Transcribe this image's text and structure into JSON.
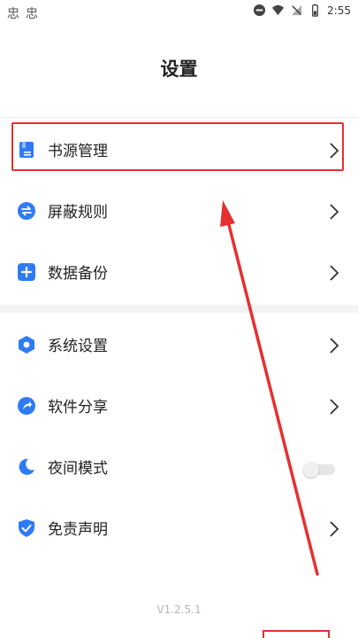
{
  "status_bar": {
    "left_icons": [
      "忠",
      "忠"
    ],
    "time": "2:55",
    "icons": [
      "dnd-icon",
      "wifi-icon",
      "signal-icon",
      "battery-icon"
    ]
  },
  "page": {
    "title": "设置",
    "version": "V1.2.5.1"
  },
  "settings": {
    "group1": [
      {
        "label": "书源管理",
        "icon": "book-source-icon",
        "color": "#2f7bf5"
      },
      {
        "label": "屏蔽规则",
        "icon": "swap-icon",
        "color": "#2f7bf5"
      },
      {
        "label": "数据备份",
        "icon": "backup-icon",
        "color": "#2f7bf5"
      }
    ],
    "group2": [
      {
        "label": "系统设置",
        "icon": "hexagon-settings-icon",
        "color": "#2f7bf5"
      },
      {
        "label": "软件分享",
        "icon": "share-icon",
        "color": "#2f7bf5"
      },
      {
        "label": "夜间模式",
        "icon": "moon-icon",
        "color": "#2f7bf5",
        "toggle_on": false
      },
      {
        "label": "免责声明",
        "icon": "shield-check-icon",
        "color": "#2f7bf5"
      }
    ]
  },
  "annotation_color": "#e53030"
}
